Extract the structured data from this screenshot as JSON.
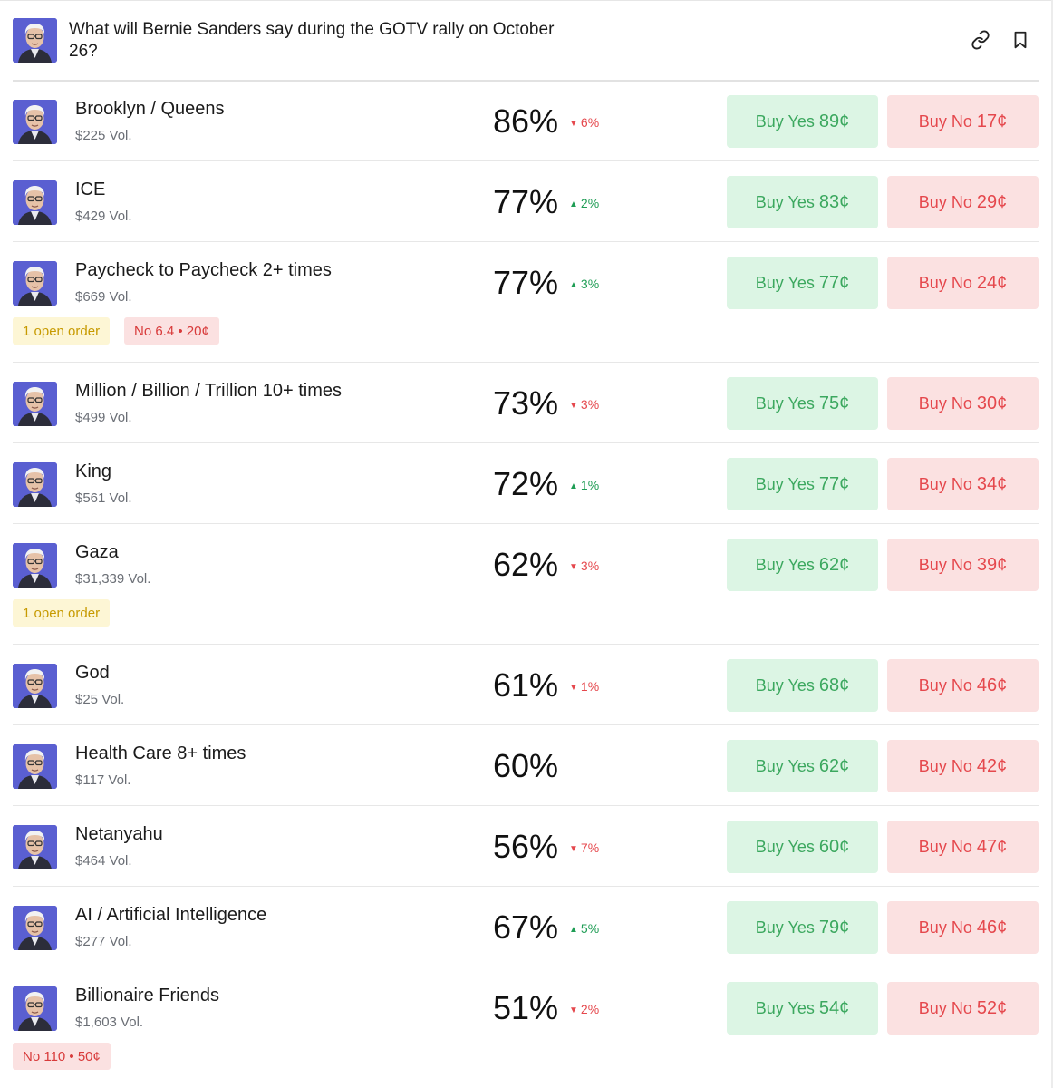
{
  "header": {
    "title": "What will Bernie Sanders say during the GOTV rally on October 26?"
  },
  "labels": {
    "buy_yes": "Buy Yes",
    "buy_no": "Buy No"
  },
  "markets": [
    {
      "name": "Brooklyn / Queens",
      "volume": "$225 Vol.",
      "percent": "86%",
      "change": "6%",
      "direction": "down",
      "yes_price": "89¢",
      "no_price": "17¢"
    },
    {
      "name": "ICE",
      "volume": "$429 Vol.",
      "percent": "77%",
      "change": "2%",
      "direction": "up",
      "yes_price": "83¢",
      "no_price": "29¢"
    },
    {
      "name": "Paycheck to Paycheck 2+ times",
      "volume": "$669 Vol.",
      "percent": "77%",
      "change": "3%",
      "direction": "up",
      "yes_price": "77¢",
      "no_price": "24¢",
      "badges": [
        {
          "kind": "open",
          "text": "1 open order"
        },
        {
          "kind": "no",
          "text": "No 6.4 • 20¢"
        }
      ]
    },
    {
      "name": "Million / Billion / Trillion 10+ times",
      "volume": "$499 Vol.",
      "percent": "73%",
      "change": "3%",
      "direction": "down",
      "yes_price": "75¢",
      "no_price": "30¢"
    },
    {
      "name": "King",
      "volume": "$561 Vol.",
      "percent": "72%",
      "change": "1%",
      "direction": "up",
      "yes_price": "77¢",
      "no_price": "34¢"
    },
    {
      "name": "Gaza",
      "volume": "$31,339 Vol.",
      "percent": "62%",
      "change": "3%",
      "direction": "down",
      "yes_price": "62¢",
      "no_price": "39¢",
      "badges": [
        {
          "kind": "open",
          "text": "1 open order"
        }
      ]
    },
    {
      "name": "God",
      "volume": "$25 Vol.",
      "percent": "61%",
      "change": "1%",
      "direction": "down",
      "yes_price": "68¢",
      "no_price": "46¢"
    },
    {
      "name": "Health Care 8+ times",
      "volume": "$117 Vol.",
      "percent": "60%",
      "change": "",
      "direction": "none",
      "yes_price": "62¢",
      "no_price": "42¢"
    },
    {
      "name": "Netanyahu",
      "volume": "$464 Vol.",
      "percent": "56%",
      "change": "7%",
      "direction": "down",
      "yes_price": "60¢",
      "no_price": "47¢"
    },
    {
      "name": "AI / Artificial Intelligence",
      "volume": "$277 Vol.",
      "percent": "67%",
      "change": "5%",
      "direction": "up",
      "yes_price": "79¢",
      "no_price": "46¢"
    },
    {
      "name": "Billionaire Friends",
      "volume": "$1,603 Vol.",
      "percent": "51%",
      "change": "2%",
      "direction": "down",
      "yes_price": "54¢",
      "no_price": "52¢",
      "badges": [
        {
          "kind": "no",
          "text": "No 110 • 50¢"
        }
      ]
    }
  ],
  "colors": {
    "yes_bg": "#dcf5e4",
    "yes_text": "#3ca85f",
    "no_bg": "#fbe1e1",
    "no_text": "#e5484d",
    "up": "#1f9d55",
    "down": "#e5484d",
    "open_order_bg": "#fdf6d5",
    "open_order_text": "#c79a00",
    "avatar_bg": "#5a5fd1"
  },
  "icons": {
    "avatar": "bernie-sanders-portrait",
    "link": "link-icon",
    "bookmark": "bookmark-icon",
    "up": "triangle-up-icon",
    "down": "triangle-down-icon"
  }
}
